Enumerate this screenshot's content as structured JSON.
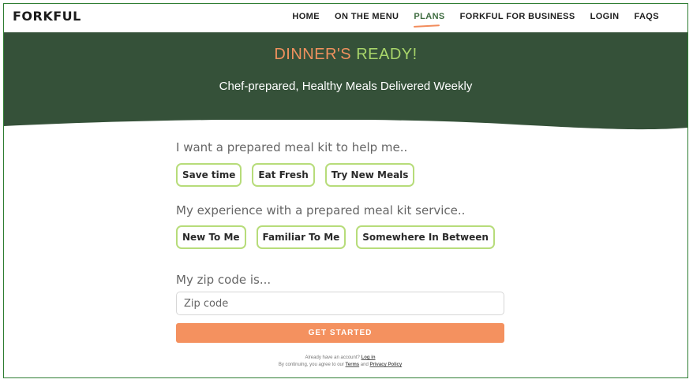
{
  "nav": {
    "logo": "FORKFUL",
    "links": [
      {
        "label": "HOME"
      },
      {
        "label": "ON THE MENU"
      },
      {
        "label": "PLANS"
      },
      {
        "label": "FORKFUL FOR BUSINESS"
      },
      {
        "label": "LOGIN"
      },
      {
        "label": "FAQS"
      }
    ],
    "active": "PLANS"
  },
  "hero": {
    "title_part1": "DINNER'S",
    "title_part2": "READY!",
    "subtitle": "Chef-prepared, Healthy Meals Delivered Weekly"
  },
  "form": {
    "q1": "I want a prepared meal kit to help me..",
    "q1_options": [
      "Save time",
      "Eat Fresh",
      "Try New Meals"
    ],
    "q2": "My experience with a prepared meal kit service..",
    "q2_options": [
      "New To Me",
      "Familiar To Me",
      "Somewhere In Between"
    ],
    "q3": "My zip code is...",
    "zip_placeholder": "Zip code",
    "cta": "GET STARTED",
    "account_prompt": "Already have an account?",
    "login_link": "Log in",
    "agree_prefix": "By continuing, you agree to our",
    "terms_link": "Terms",
    "and": "and",
    "privacy_link": "Privacy Policy"
  },
  "colors": {
    "hero_bg": "#355139",
    "accent_orange": "#f4915f",
    "accent_green": "#a8d56a",
    "option_border": "#b7dc7a"
  }
}
